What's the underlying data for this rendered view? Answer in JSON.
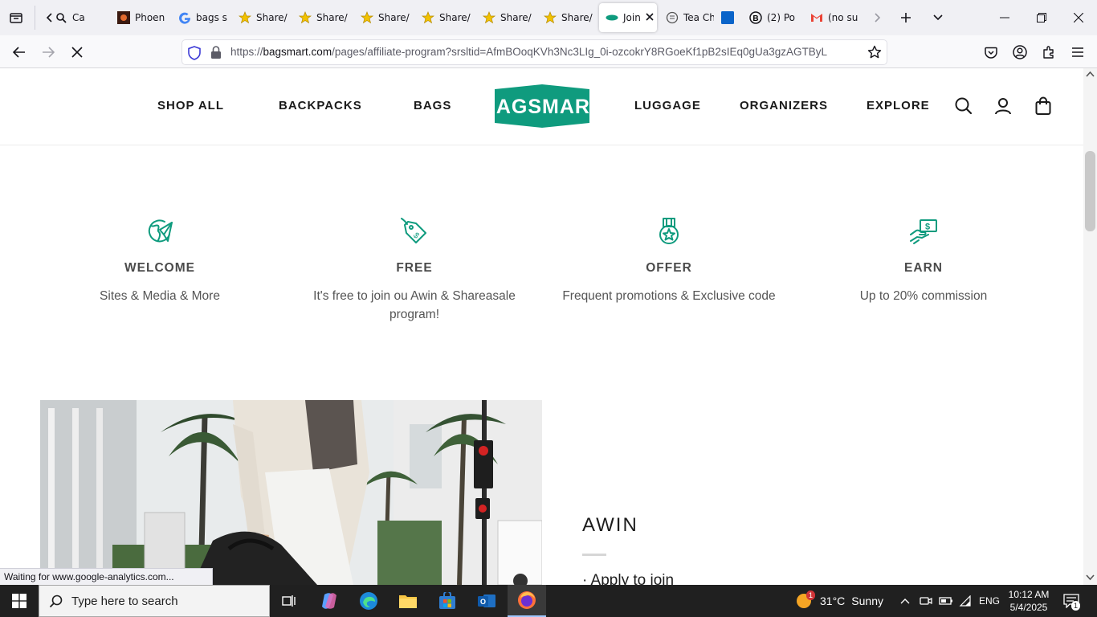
{
  "browser": {
    "tabs": [
      {
        "label": "Ca",
        "icon": "magnifier-icon"
      },
      {
        "label": "Phoen",
        "icon": "phoenix-site-icon"
      },
      {
        "label": "bags s",
        "icon": "google-icon"
      },
      {
        "label": "Share/",
        "icon": "star-icon"
      },
      {
        "label": "Share/",
        "icon": "star-icon"
      },
      {
        "label": "Share/",
        "icon": "star-icon"
      },
      {
        "label": "Share/",
        "icon": "star-icon"
      },
      {
        "label": "Share/",
        "icon": "star-icon"
      },
      {
        "label": "Share/",
        "icon": "star-icon"
      },
      {
        "label": "Join",
        "icon": "bagsmart-favicon",
        "active": true
      },
      {
        "label": "Tea Ch",
        "icon": "tea-icon"
      },
      {
        "label": "",
        "icon": "blue-square-icon"
      },
      {
        "label": "(2) Po",
        "icon": "b-icon"
      },
      {
        "label": "(no su",
        "icon": "gmail-icon"
      }
    ],
    "url_host": "bagsmart.com",
    "url_prefix": "https://",
    "url_path": "/pages/affiliate-program?srsltid=AfmBOoqKVh3Nc3LIg_0i-ozcokrY8RGoeKf1pB2sIEq0gUa3gzAGTByL",
    "status_text": "Waiting for www.google-analytics.com..."
  },
  "site": {
    "menu_left": [
      "SHOP ALL",
      "BACKPACKS",
      "BAGS"
    ],
    "menu_right": [
      "LUGGAGE",
      "ORGANIZERS",
      "EXPLORE"
    ],
    "logo_text": "BAGSMART",
    "brand_color": "#0f9b7e"
  },
  "features": [
    {
      "icon": "globe-send-icon",
      "title": "WELCOME",
      "desc": "Sites & Media & More"
    },
    {
      "icon": "price-tag-icon",
      "title": "FREE",
      "desc": "It's free to join ou Awin & Shareasale program!"
    },
    {
      "icon": "medal-icon",
      "title": "OFFER",
      "desc": "Frequent promotions & Exclusive code"
    },
    {
      "icon": "money-hand-icon",
      "title": "EARN",
      "desc": "Up to 20% commission"
    }
  ],
  "awin": {
    "title": "AWIN",
    "apply": "· Apply to join"
  },
  "taskbar": {
    "search_placeholder": "Type here to search",
    "weather_temp": "31°C",
    "weather_text": "Sunny",
    "weather_badge": "1",
    "lang": "ENG",
    "time": "10:12 AM",
    "date": "5/4/2025",
    "notif_count": "1"
  }
}
